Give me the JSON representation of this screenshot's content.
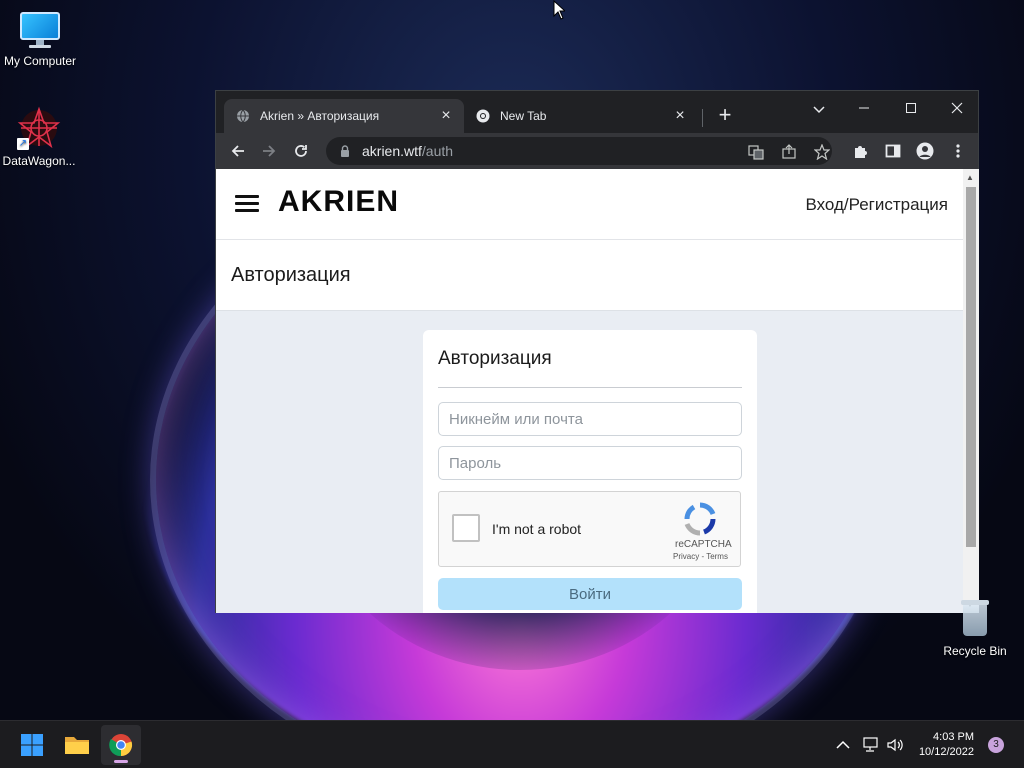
{
  "desktop": {
    "icons": [
      {
        "label": "My Computer",
        "icon": "monitor-icon"
      },
      {
        "label": "DataWagon...",
        "icon": "datawagon-icon"
      },
      {
        "label": "Recycle Bin",
        "icon": "recycle-bin-icon"
      }
    ]
  },
  "browser": {
    "tabs": [
      {
        "title": "Akrien » Авторизация",
        "favicon": "globe-icon",
        "active": true
      },
      {
        "title": "New Tab",
        "favicon": "chrome-icon",
        "active": false
      }
    ],
    "window_controls": {
      "dropdown": "⌵",
      "minimize": "—",
      "maximize": "☐",
      "close": "✕"
    },
    "address": {
      "host": "akrien.wtf",
      "path": "/auth"
    }
  },
  "page": {
    "logo": "AKRIEN",
    "login_link": "Вход/Регистрация",
    "page_title": "Авторизация",
    "form": {
      "title": "Авторизация",
      "username_placeholder": "Никнейм или почта",
      "password_placeholder": "Пароль",
      "captcha_label": "I'm not a robot",
      "captcha_brand": "reCAPTCHA",
      "captcha_links": "Privacy - Terms",
      "submit_label": "Войти"
    }
  },
  "taskbar": {
    "time": "4:03 PM",
    "date": "10/12/2022",
    "notifications": "3"
  },
  "colors": {
    "accent_button": "#b3e1fb",
    "chrome_dark": "#202124",
    "chrome_toolbar": "#35363a"
  }
}
